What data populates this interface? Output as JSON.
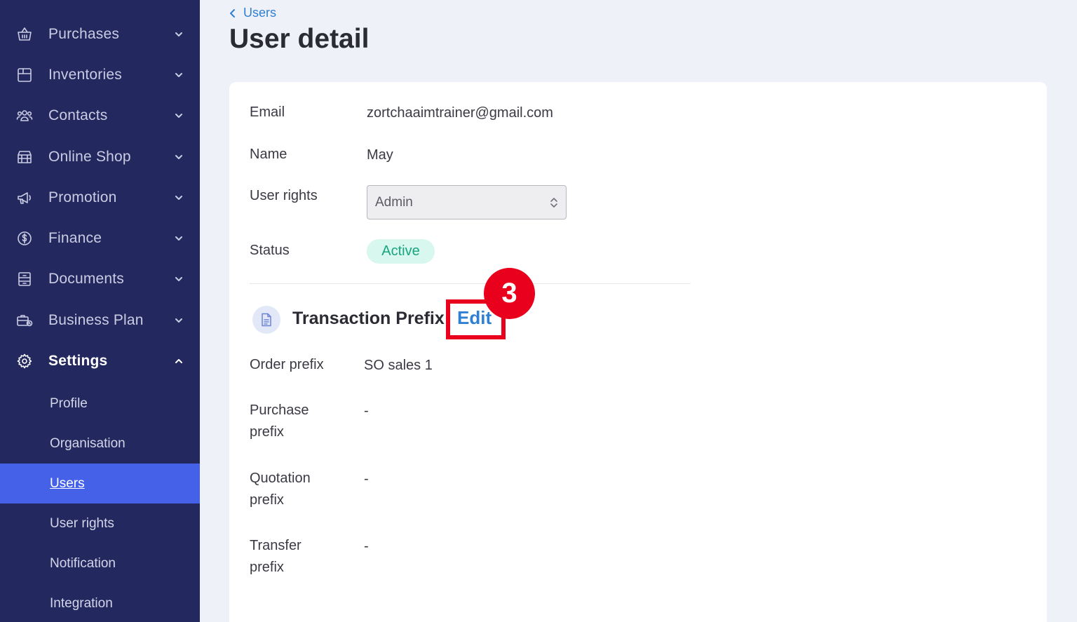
{
  "sidebar": {
    "items": [
      {
        "label": "Purchases",
        "icon": "basket-icon"
      },
      {
        "label": "Inventories",
        "icon": "box-icon"
      },
      {
        "label": "Contacts",
        "icon": "people-icon"
      },
      {
        "label": "Online Shop",
        "icon": "shop-icon"
      },
      {
        "label": "Promotion",
        "icon": "megaphone-icon"
      },
      {
        "label": "Finance",
        "icon": "dollar-circle-icon"
      },
      {
        "label": "Documents",
        "icon": "document-icon"
      },
      {
        "label": "Business Plan",
        "icon": "briefcase-icon"
      },
      {
        "label": "Settings",
        "icon": "gear-icon"
      }
    ],
    "settings_subitems": [
      {
        "label": "Profile"
      },
      {
        "label": "Organisation"
      },
      {
        "label": "Users"
      },
      {
        "label": "User rights"
      },
      {
        "label": "Notification"
      },
      {
        "label": "Integration"
      }
    ],
    "selected_subitem": "Users"
  },
  "breadcrumb": {
    "label": "Users"
  },
  "page": {
    "title": "User detail"
  },
  "user": {
    "email_label": "Email",
    "email_value": "zortchaaimtrainer@gmail.com",
    "name_label": "Name",
    "name_value": "May",
    "rights_label": "User rights",
    "rights_value": "Admin",
    "status_label": "Status",
    "status_value": "Active"
  },
  "prefix_section": {
    "title": "Transaction Prefix",
    "edit_label": "Edit",
    "order_label": "Order prefix",
    "order_value": "SO sales 1",
    "purchase_label_1": "Purchase",
    "purchase_label_2": "prefix",
    "purchase_value": "-",
    "quotation_label_1": "Quotation",
    "quotation_label_2": "prefix",
    "quotation_value": "-",
    "transfer_label_1": "Transfer",
    "transfer_label_2": "prefix",
    "transfer_value": "-"
  },
  "annotation": {
    "step_number": "3"
  },
  "colors": {
    "sidebar_bg": "#23285e",
    "selected_bg": "#4561e8",
    "link": "#2f7fd2",
    "badge_bg": "#d7f7ef",
    "badge_text": "#19a57e",
    "annotation_red": "#e8001c"
  }
}
